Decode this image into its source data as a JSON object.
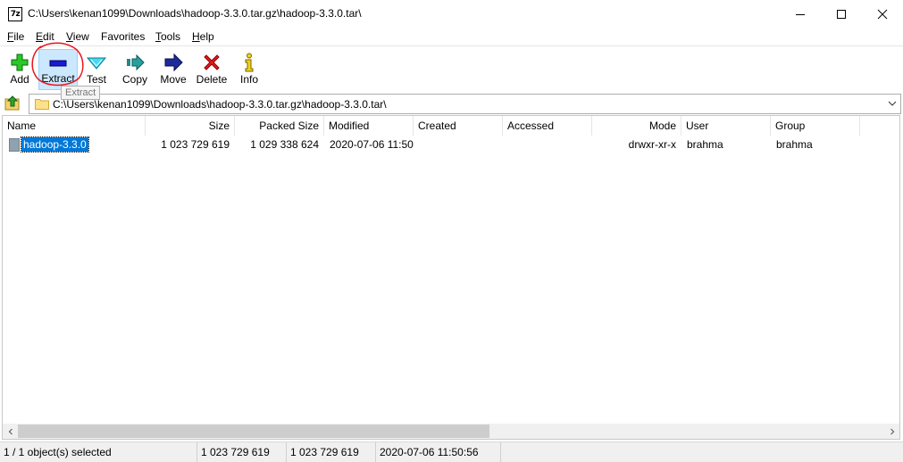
{
  "window": {
    "title": "C:\\Users\\kenan1099\\Downloads\\hadoop-3.3.0.tar.gz\\hadoop-3.3.0.tar\\",
    "app_icon_text": "7z",
    "controls": [
      "minimize-icon",
      "maximize-icon",
      "close-icon"
    ]
  },
  "menu": [
    {
      "label": "File",
      "accel": "F",
      "rest": "ile"
    },
    {
      "label": "Edit",
      "accel": "E",
      "rest": "dit"
    },
    {
      "label": "View",
      "accel": "V",
      "rest": "iew"
    },
    {
      "label": "Favorites",
      "accel": "",
      "rest": "Favorites"
    },
    {
      "label": "Tools",
      "accel": "T",
      "rest": "ools"
    },
    {
      "label": "Help",
      "accel": "H",
      "rest": "elp"
    }
  ],
  "toolbar": {
    "add": "Add",
    "extract": "Extract",
    "test": "Test",
    "copy": "Copy",
    "move": "Move",
    "delete": "Delete",
    "info": "Info",
    "hovered": "extract",
    "tooltip": "Extract"
  },
  "address": {
    "path": "C:\\Users\\kenan1099\\Downloads\\hadoop-3.3.0.tar.gz\\hadoop-3.3.0.tar\\"
  },
  "columns": [
    "Name",
    "Size",
    "Packed Size",
    "Modified",
    "Created",
    "Accessed",
    "Mode",
    "User",
    "Group"
  ],
  "files": [
    {
      "name": "hadoop-3.3.0",
      "size": "1 023 729 619",
      "packed_size": "1 029 338 624",
      "modified": "2020-07-06 11:50",
      "created": "",
      "accessed": "",
      "mode": "drwxr-xr-x",
      "user": "brahma",
      "group": "brahma",
      "selected": true
    }
  ],
  "status": {
    "selection": "1 / 1 object(s) selected",
    "size": "1 023 729 619",
    "packed": "1 023 729 619",
    "modified": "2020-07-06 11:50:56"
  },
  "colors": {
    "selection": "#0078d7",
    "hover_toolbar": "#cce8ff",
    "annotation": "#e8141a"
  }
}
